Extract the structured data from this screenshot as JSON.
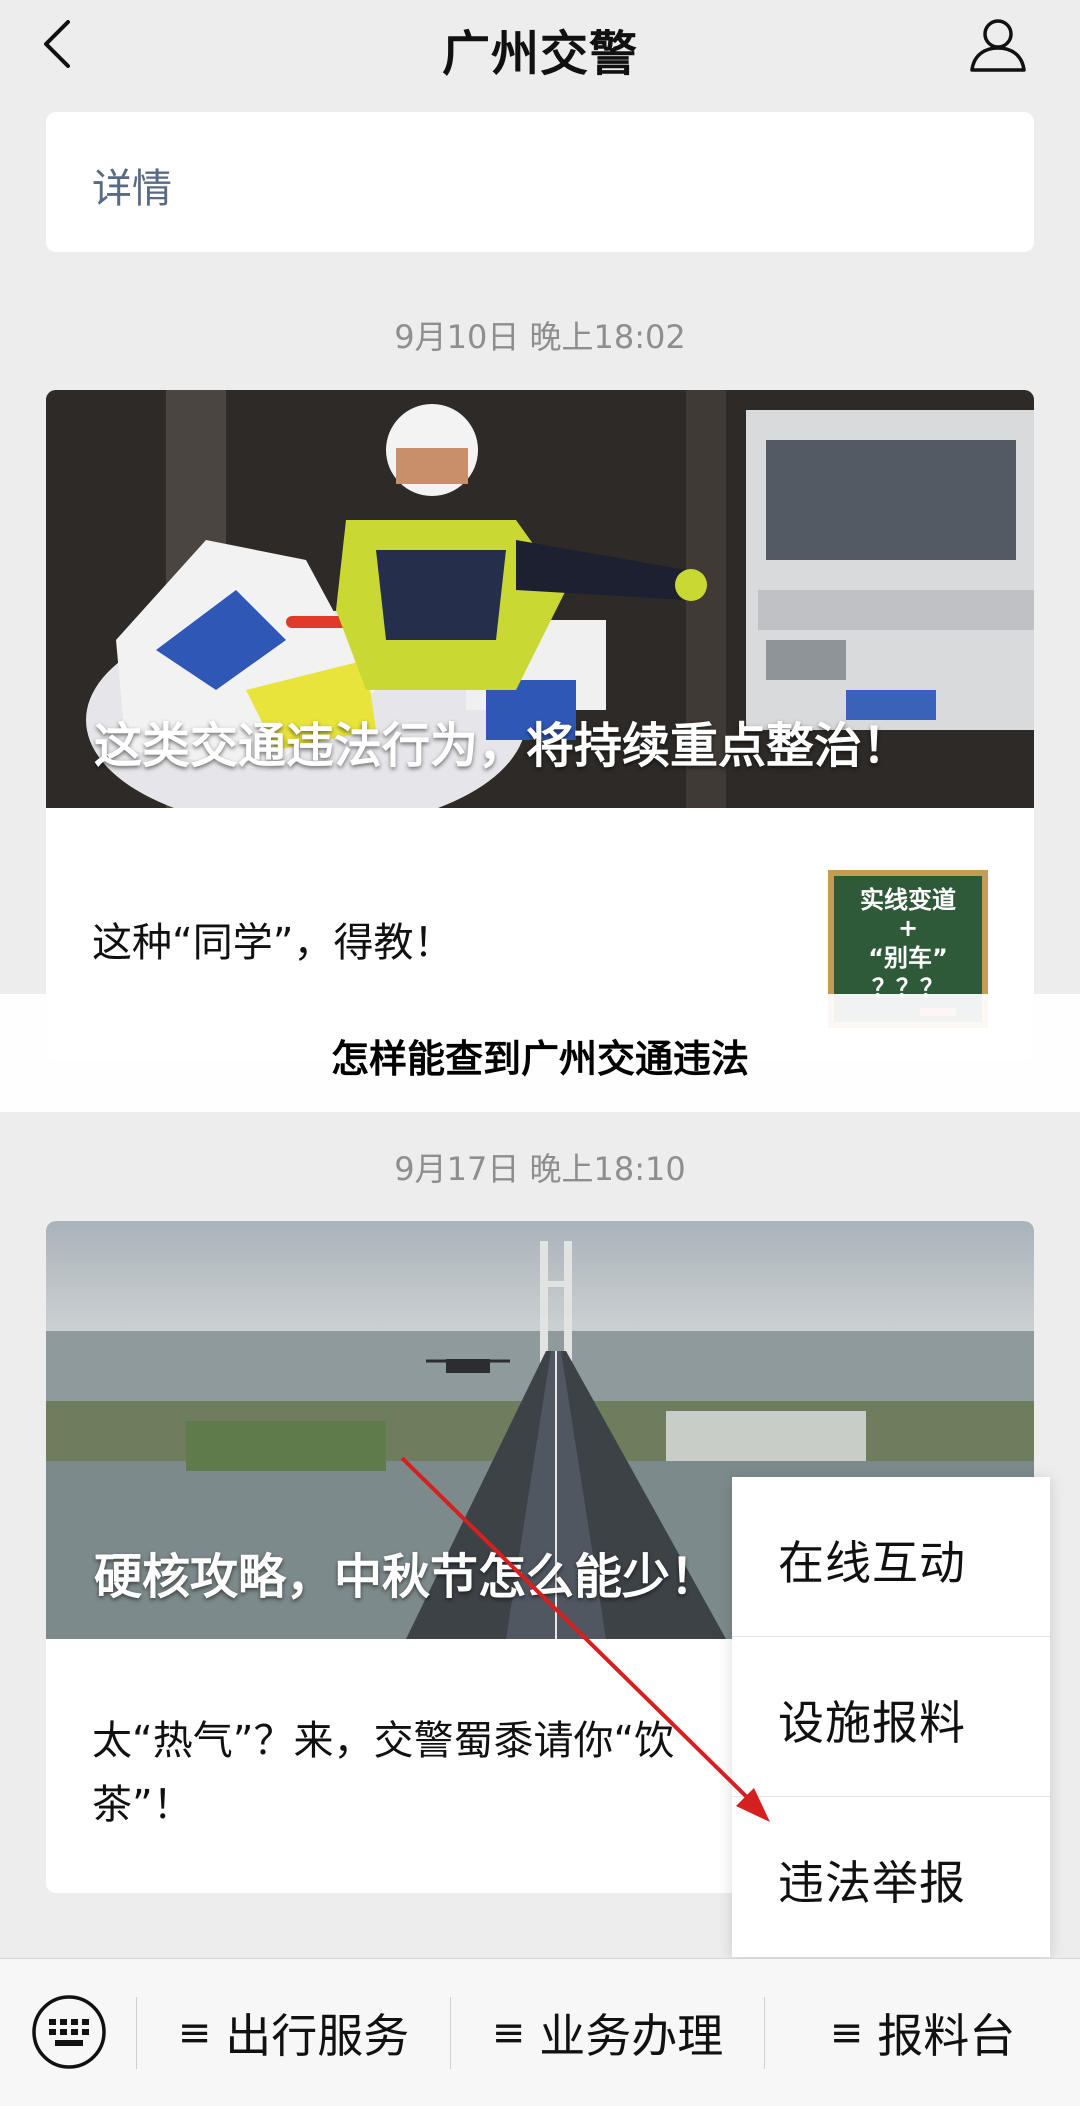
{
  "header": {
    "title": "广州交警",
    "back_icon": "chevron-left-icon",
    "profile_icon": "user-icon"
  },
  "detail_card": {
    "label": "详情"
  },
  "messages": [
    {
      "timestamp": "9月10日 晚上18:02",
      "cover_title": "这类交通违法行为，将持续重点整治！",
      "sub_title": "这种“同学”，得教！",
      "thumb_lines": [
        "实线变道",
        "+",
        "“别车”",
        "？？？"
      ]
    },
    {
      "timestamp": "9月17日 晚上18:10",
      "cover_title": "硬核攻略，中秋节怎么能少！",
      "sub_title": "太“热气”？来，交警蜀黍请你“饮茶”！"
    }
  ],
  "banner": {
    "text": "怎样能查到广州交通违法"
  },
  "popup_menu": {
    "items": [
      "在线互动",
      "设施报料",
      "违法举报"
    ]
  },
  "bottom_bar": {
    "keyboard_icon": "keyboard-icon",
    "menu_glyph": "≡",
    "buttons": [
      "出行服务",
      "业务办理",
      "报料台"
    ]
  },
  "colors": {
    "background": "#ededed",
    "link_text": "#5a6a84",
    "timestamp": "#8e8e8e",
    "annotation_arrow": "#d62020"
  }
}
